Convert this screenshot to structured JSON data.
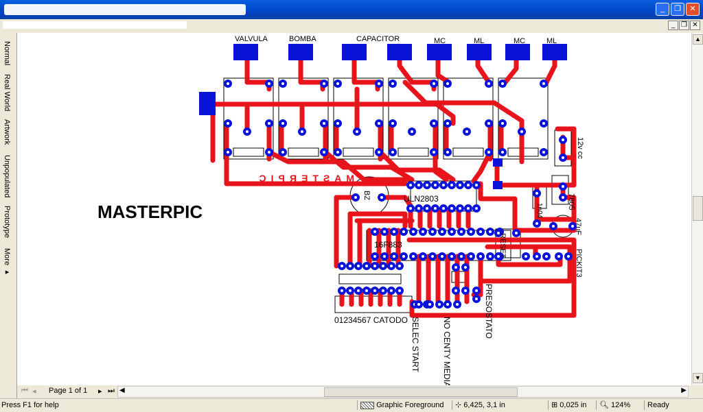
{
  "window": {
    "title": "",
    "minimize_glyph": "_",
    "restore_glyph": "❐",
    "close_glyph": "✕"
  },
  "menu": {
    "minimize_glyph": "_",
    "restore_glyph": "❐",
    "close_glyph": "✕"
  },
  "sidebar": {
    "tabs": [
      "Normal",
      "Real World",
      "Artwork",
      "Unpopulated",
      "Prototype",
      "More ▸"
    ]
  },
  "board": {
    "main_title": "MASTERPIC",
    "mirror_label": "MASTERPIC",
    "labels": {
      "valvula": "VALVULA",
      "bomba": "BOMBA",
      "capacitor": "CAPACITOR",
      "mc1": "MC",
      "ml1": "ML",
      "mc2": "MC",
      "ml2": "ML",
      "power": "12v cc",
      "bz": "BZ",
      "uln": "ULN2803",
      "pic": "16F883",
      "reset": "RESET",
      "reg": "7805",
      "diode": "1n04",
      "cap": "47uF",
      "pickit": "PICKIT3",
      "display": "01234567 CATODO",
      "selec": "SELEC START",
      "nocenty": "NO CENTY MEDIA",
      "presostato": "PRESOSTATO"
    }
  },
  "pagebar": {
    "page_label": "Page 1 of 1"
  },
  "status": {
    "help": "Press F1 for help",
    "layer": "Graphic Foreground",
    "coords": "6,425, 3,1 in",
    "grid": "0,025 in",
    "zoom": "124%",
    "state": "Ready"
  },
  "colors": {
    "track": "#e8141c",
    "pad": "#0a14d8",
    "silk": "#000000"
  }
}
